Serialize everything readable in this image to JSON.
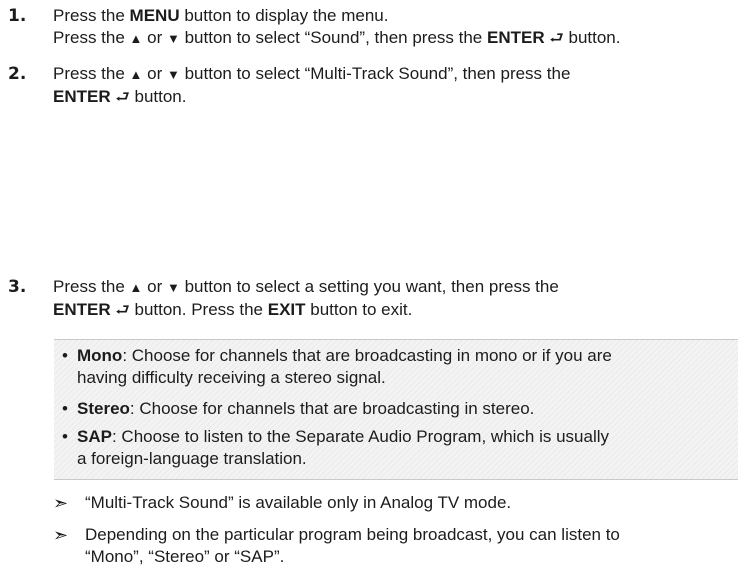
{
  "steps": [
    {
      "number": "1.",
      "line1": [
        "Press the ",
        "MENU",
        " button to display the menu."
      ],
      "line2": [
        "Press the ",
        "▲",
        " or ",
        "▼",
        " button to select “Sound”, then press the ",
        "ENTER",
        " button."
      ]
    },
    {
      "number": "2.",
      "line1": [
        "Press the ",
        "▲",
        " or ",
        "▼",
        " button to select “Multi-Track Sound”, then press the"
      ],
      "line2": [
        "ENTER",
        " button."
      ]
    },
    {
      "number": "3.",
      "line1": [
        "Press the ",
        "▲",
        " or ",
        "▼",
        " button to select a setting you want, then press the"
      ],
      "line2": [
        "ENTER",
        " button. Press the ",
        "EXIT",
        " button to exit."
      ]
    }
  ],
  "enter_icon": "enter-return-icon",
  "options": [
    {
      "bullet": "•",
      "name": "Mono",
      "line1": ": Choose for channels that are broadcasting in mono or if you are",
      "line2": "having difficulty receiving a stereo signal."
    },
    {
      "bullet": "•",
      "name": "Stereo",
      "line1": ": Choose for channels that are broadcasting in stereo.",
      "line2": ""
    },
    {
      "bullet": "•",
      "name": "SAP",
      "line1": ": Choose to listen to the Separate Audio Program, which is usually",
      "line2": "a foreign-language translation."
    }
  ],
  "notes": [
    {
      "arrow": "➣",
      "line1": "“Multi-Track Sound” is available only in Analog TV mode.",
      "line2": ""
    },
    {
      "arrow": "➣",
      "line1": "Depending on the particular program being broadcast, you can listen to",
      "line2": "“Mono”, “Stereo” or “SAP”."
    }
  ]
}
